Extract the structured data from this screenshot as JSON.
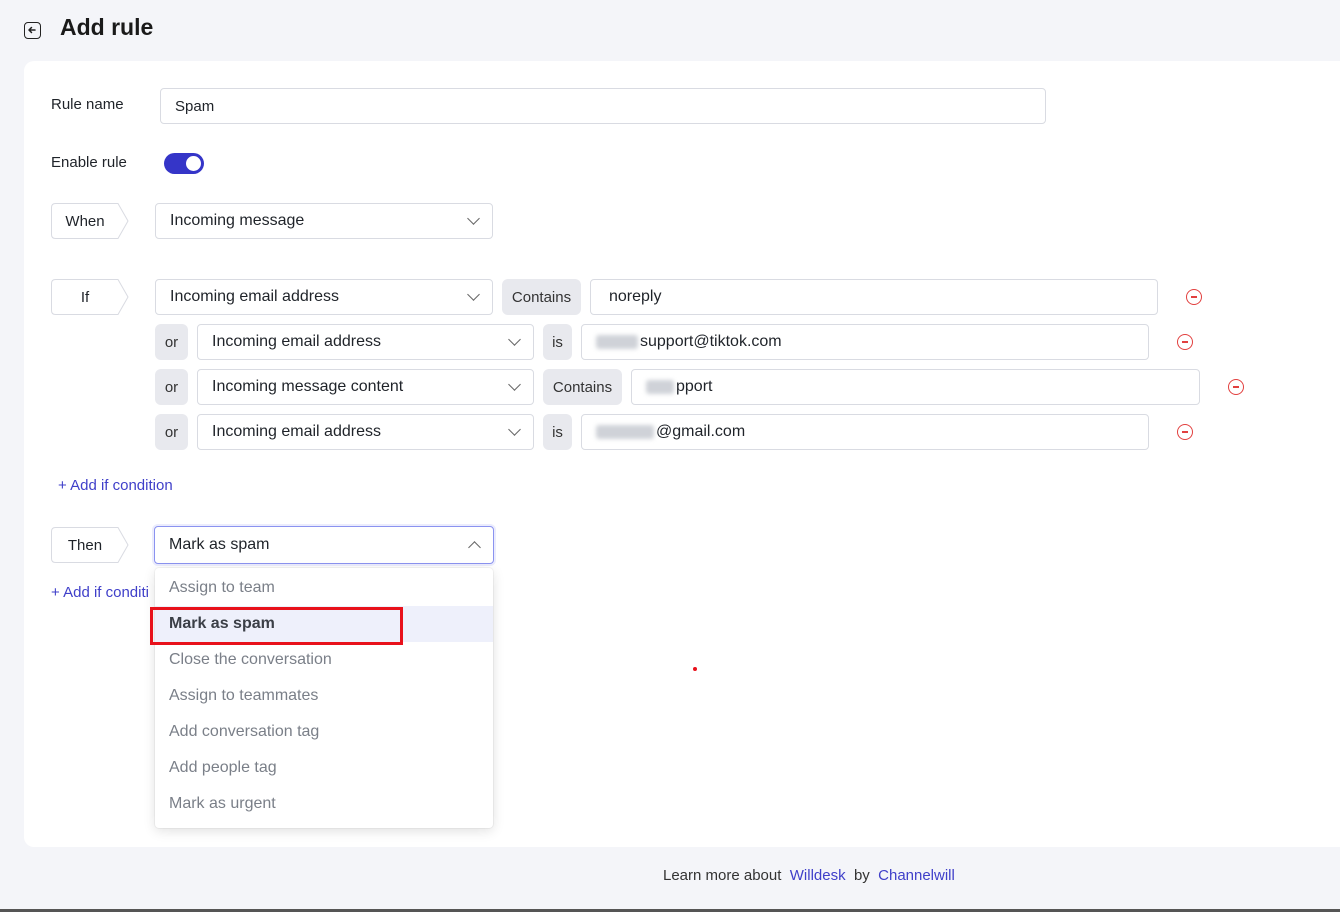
{
  "header": {
    "title": "Add rule"
  },
  "rule_name": {
    "label": "Rule name",
    "value": "Spam"
  },
  "enable_rule": {
    "label": "Enable rule",
    "enabled": true
  },
  "when": {
    "label": "When",
    "trigger": "Incoming message"
  },
  "if": {
    "label": "If",
    "conditions": [
      {
        "connector": "",
        "field": "Incoming email address",
        "operator": "Contains",
        "value": "noreply"
      },
      {
        "connector": "or",
        "field": "Incoming email address",
        "operator": "is",
        "value": "support@tiktok.com"
      },
      {
        "connector": "or",
        "field": "Incoming message content",
        "operator": "Contains",
        "value": "pport"
      },
      {
        "connector": "or",
        "field": "Incoming email address",
        "operator": "is",
        "value": "@gmail.com"
      }
    ],
    "add_label": "+ Add if condition"
  },
  "then": {
    "label": "Then",
    "action": "Mark as spam",
    "add_label": "+ Add if conditi",
    "options": [
      "Assign to team",
      "Mark as spam",
      "Close the conversation",
      "Assign to teammates",
      "Add conversation tag",
      "Add people tag",
      "Mark as urgent"
    ],
    "selected_index": 1
  },
  "footer": {
    "prefix": "Learn more about",
    "product": "Willdesk",
    "by": "by",
    "company": "Channelwill"
  },
  "colors": {
    "accent": "#3535c8",
    "link": "#3f3fc9",
    "danger": "#e2403f",
    "highlight": "#e8111b"
  }
}
